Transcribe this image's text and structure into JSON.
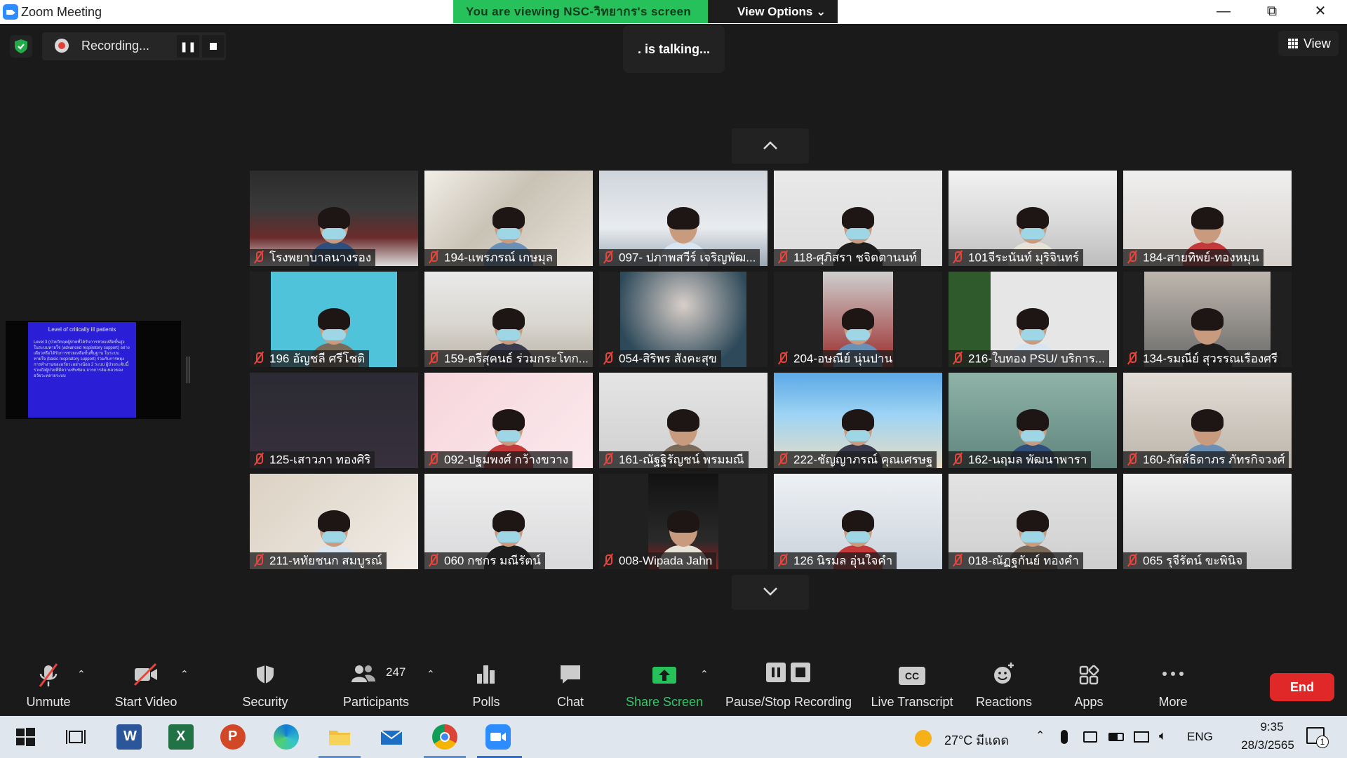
{
  "window": {
    "title": "Zoom Meeting"
  },
  "share_banner": {
    "text": "You are viewing NSC-วิทยากร's screen",
    "view_options": "View Options ⌄"
  },
  "recording": {
    "label": "Recording..."
  },
  "talking": {
    "text": ". is talking..."
  },
  "view_button": {
    "label": "View"
  },
  "shared_slide": {
    "title": "Level of critically ill patients",
    "text": "Level 3 (ป่วยวิกฤตผู้ป่วยที่ได้รับการช่วยเหลือขั้นสูง ในระบบหายใจ (advanced respiratory support) อย่างเดียวหรือได้รับการช่วยเหลือขั้นพื้นฐาน ในระบบหายใจ (basic respiratory support) ร่วมกับการพยุงการทำงานของอวัยวะอย่างน้อย 2 ระบบ ผู้ป่วยระดับนี้รวมถึงผู้ป่วยที่มีความซับซ้อน จากการล้มเหลวของอวัยวะหลายระบบ"
  },
  "participants_grid": [
    {
      "name": "โรงพยาบาลนางรอง",
      "scene": "room"
    },
    {
      "name": "194-แพรภรณ์ เกษมุล",
      "scene": "blurry"
    },
    {
      "name": "097- ปภาพสวีร์ เจริญพัฒ...",
      "scene": "nurse"
    },
    {
      "name": "118-ศุภิสรา ชจิตตานนท์",
      "scene": "head-low"
    },
    {
      "name": "101จีระนันท์ มุริจินทร์",
      "scene": "ceiling"
    },
    {
      "name": "184-สายทิพย์-ทองหมุน",
      "scene": "face"
    },
    {
      "name": "196 อัญชลี ศรีโชติ",
      "scene": "portrait-cyan"
    },
    {
      "name": "159-ตรีสุคนธ์ ร่วมกระโทก...",
      "scene": "classroom"
    },
    {
      "name": "054-สิริพร สังคะสุข",
      "scene": "blur-dark"
    },
    {
      "name": "204-อษณีย์ นุ่นปาน",
      "scene": "portrait-red"
    },
    {
      "name": "216-ใบทอง PSU/ บริการ...",
      "scene": "green-wall"
    },
    {
      "name": "134-รมณีย์ สุวรรณเรืองศรี",
      "scene": "window"
    },
    {
      "name": "125-เสาวภา ทองศิริ",
      "scene": "dark"
    },
    {
      "name": "092-ปฐมพงศ์ กว้างขวาง",
      "scene": "pink"
    },
    {
      "name": "161-ณัฐฐิรัญชน์ พรมมณี",
      "scene": "wall"
    },
    {
      "name": "222-ชัญญาภรณ์ คุณเศรษฐ",
      "scene": "beach"
    },
    {
      "name": "162-นฤมล พัฒนาพารา",
      "scene": "teal-room"
    },
    {
      "name": "160-ภัสส์ธิดาภร ภัทรกิจวงศ์",
      "scene": "sofa"
    },
    {
      "name": "211-หทัยชนก สมบูรณ์",
      "scene": "glasses"
    },
    {
      "name": "060 กชกร มณีรัตน์",
      "scene": "bedroom"
    },
    {
      "name": "008-Wipada Jahn",
      "scene": "portrait-dark"
    },
    {
      "name": "126 นิรมล อุ่นใจคำ",
      "scene": "office"
    },
    {
      "name": "018-ณัฏฐกันย์ ทองคำ",
      "scene": "nurse2"
    },
    {
      "name": "065 รุจีรัตน์ ขะพินิจ",
      "scene": "ceiling2"
    }
  ],
  "toolbar": {
    "unmute": "Unmute",
    "start_video": "Start Video",
    "security": "Security",
    "participants": "Participants",
    "participant_count": "247",
    "polls": "Polls",
    "chat": "Chat",
    "share_screen": "Share Screen",
    "pause_stop_recording": "Pause/Stop Recording",
    "live_transcript": "Live Transcript",
    "cc": "CC",
    "reactions": "Reactions",
    "apps": "Apps",
    "more": "More",
    "end": "End"
  },
  "taskbar": {
    "weather": "27°C มีแดด",
    "language": "ENG",
    "time": "9:35",
    "date": "28/3/2565",
    "notification_count": "1"
  },
  "colors": {
    "share_green": "#27c15b",
    "end_red": "#e02828",
    "toolbar_bg": "#1a1a1a"
  }
}
